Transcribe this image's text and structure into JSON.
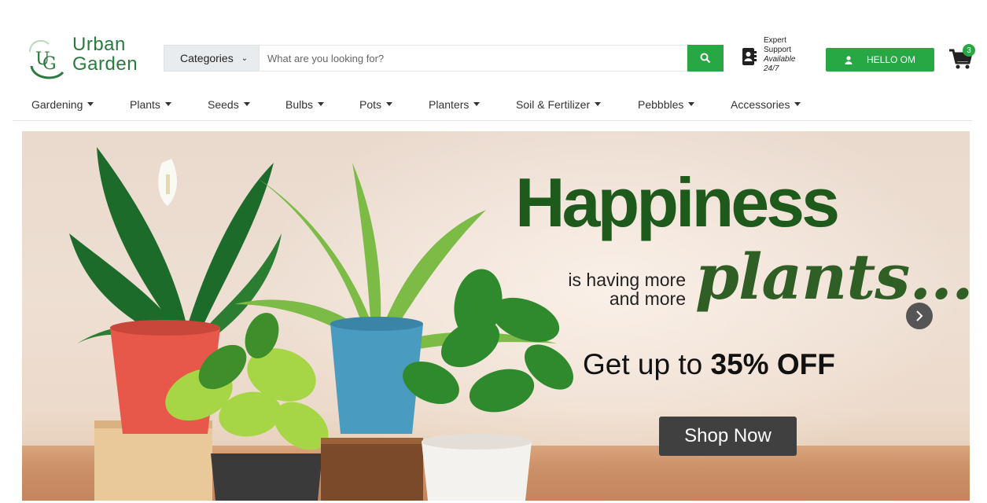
{
  "brand": {
    "line1": "Urban",
    "line2": "Garden",
    "mark_color": "#2c7a3f"
  },
  "search": {
    "category_label": "Categories",
    "placeholder": "What are you looking for?"
  },
  "support": {
    "line1": "Expert",
    "line2": "Support",
    "line3": "Available",
    "line4": "24/7"
  },
  "account": {
    "label": "HELLO OM"
  },
  "cart": {
    "count": "3"
  },
  "nav": [
    {
      "label": "Gardening"
    },
    {
      "label": "Plants"
    },
    {
      "label": "Seeds"
    },
    {
      "label": "Bulbs"
    },
    {
      "label": "Pots"
    },
    {
      "label": "Planters"
    },
    {
      "label": "Soil & Fertilizer"
    },
    {
      "label": "Pebbbles"
    },
    {
      "label": "Accessories"
    }
  ],
  "banner": {
    "headline": "Happiness",
    "tagline1": "is having more",
    "tagline2": "and more",
    "script_word": "plants...",
    "offer_prefix": "Get up to ",
    "offer_bold": "35% OFF",
    "cta": "Shop Now"
  },
  "colors": {
    "accent": "#28a745",
    "headline": "#1f5a1d"
  }
}
